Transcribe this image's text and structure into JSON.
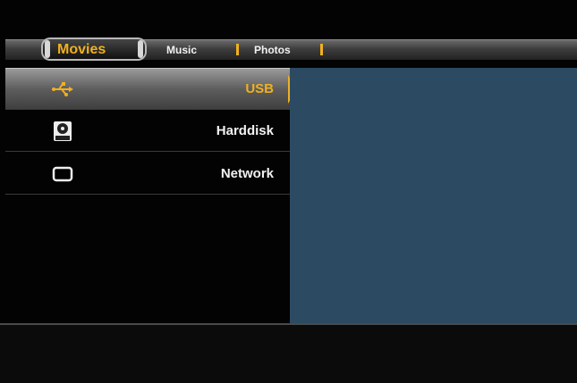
{
  "tabs": [
    {
      "label": "Movies",
      "active": true
    },
    {
      "label": "Music",
      "active": false
    },
    {
      "label": "Photos",
      "active": false
    }
  ],
  "menu": {
    "items": [
      {
        "label": "USB",
        "icon": "usb-icon",
        "selected": true
      },
      {
        "label": "Harddisk",
        "icon": "harddisk-icon",
        "selected": false
      },
      {
        "label": "Network",
        "icon": "network-icon",
        "selected": false
      }
    ]
  },
  "colors": {
    "accent": "#f0b020",
    "preview_bg": "#2c4a62",
    "background": "#030303"
  }
}
